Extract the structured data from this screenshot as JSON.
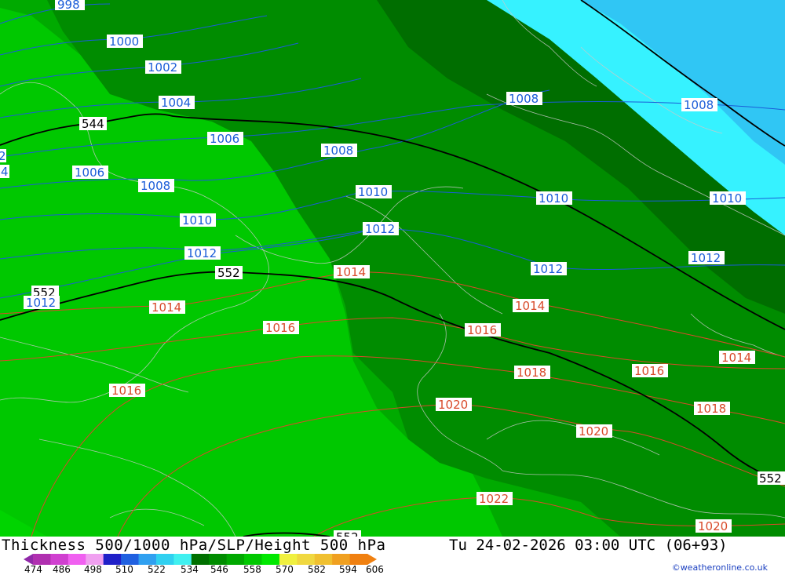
{
  "map": {
    "colors": {
      "band_light": "#00c800",
      "band_mid": "#00aa00",
      "band_dark": "#008c00",
      "band_darkest": "#006e00",
      "sea_cyan": "#36f2ff",
      "sea_blue": "#30c6f4",
      "slp_line": "#1a5cd8",
      "temp_line": "#d84a2a",
      "height_line": "#000000",
      "coast": "#c9c9c9"
    },
    "height_labels": [
      "544",
      "552",
      "552",
      "552",
      "552"
    ],
    "slp_labels_blue": [
      "998",
      "1000",
      "1002",
      "1004",
      "1006",
      "1006",
      "1008",
      "1008",
      "1008",
      "1008",
      "1010",
      "1010",
      "1010",
      "1012",
      "1012",
      "1012",
      "1012",
      "1012",
      "2",
      "4"
    ],
    "slp_labels_red": [
      "1014",
      "1014",
      "1014",
      "1014",
      "1016",
      "1016",
      "1016",
      "1016",
      "1018",
      "1018",
      "1020",
      "1020",
      "1020",
      "1022"
    ]
  },
  "footer": {
    "title": "Thickness 500/1000 hPa/SLP/Height 500 hPa",
    "datetime": "Tu 24-02-2026 03:00 UTC (06+93)",
    "credit": "©weatheronline.co.uk",
    "scale_ticks": [
      "474",
      "486",
      "498",
      "510",
      "522",
      "534",
      "546",
      "558",
      "570",
      "582",
      "594",
      "606"
    ],
    "scale_colors": [
      "#b030b0",
      "#d040d0",
      "#f060f0",
      "#f0a0f0",
      "#2020c8",
      "#2060e0",
      "#30a0f0",
      "#30d0f0",
      "#40f0f0",
      "#007000",
      "#008c00",
      "#00a800",
      "#00c800",
      "#00e800",
      "#f0f040",
      "#f0d840",
      "#f0c030",
      "#f0a020",
      "#f08010"
    ]
  }
}
